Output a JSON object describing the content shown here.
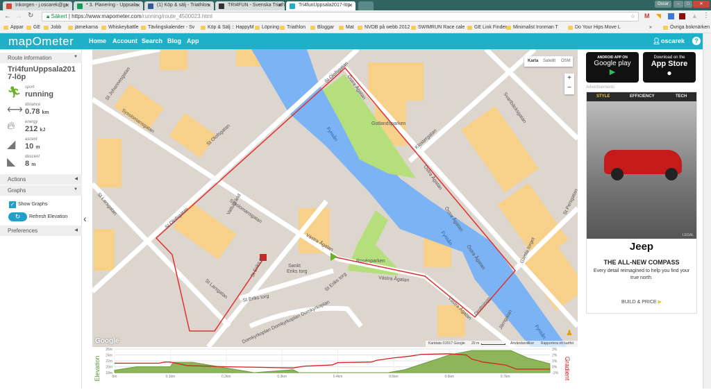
{
  "browser": {
    "tabs": [
      {
        "title": "Inkorgen - j.oscarek@gr",
        "icon_color": "#d44638"
      },
      {
        "title": "* 3. Planering - Uppsala",
        "icon_color": "#0f9d58"
      },
      {
        "title": "(1) Köp & sälj - Triathlon",
        "icon_color": "#3b5998"
      },
      {
        "title": "TRI4FUN - Svenska Triath",
        "icon_color": "#333333"
      },
      {
        "title": "Tri4funUppsala2017-löp",
        "icon_color": "#1fb0c9",
        "active": true
      }
    ],
    "user_button": "Oscar",
    "secure_label": "Säkert",
    "url_host": "https://www.mapometer.com",
    "url_path": "/running/route_4500023.html",
    "bookmarks": [
      "Appar",
      "GE",
      "Jobb",
      "järnekarna",
      "Whiskeybattle",
      "Tävlingskalender - Sv",
      "Köp & Sälj :: HappyM",
      "Löpning",
      "Triathlon",
      "Bloggar",
      "Mat",
      "NVDB på webb 2012",
      "SWIMRUN Race cale",
      "GE Link Finder",
      "Minimalist Ironman T",
      "Do Your Hips Move L"
    ],
    "bookmarks_overflow": "»",
    "other_bookmarks": "Övriga bokmärken"
  },
  "header": {
    "logo": "mapOmeter",
    "nav": [
      "Home",
      "Account",
      "Search",
      "Blog",
      "App"
    ],
    "user": "oscarek",
    "help": "?"
  },
  "sidebar": {
    "route_info_label": "Route information",
    "route_name": "Tri4funUppsala2017-löp",
    "stats": [
      {
        "label": "sport",
        "value": "running",
        "unit": "",
        "icon": "runner-icon",
        "color": "#6bb12e"
      },
      {
        "label": "distance",
        "value": "0.78",
        "unit": "km",
        "icon": "distance-arrow-icon"
      },
      {
        "label": "energy",
        "value": "212",
        "unit": "kJ",
        "icon": "flame-icon"
      },
      {
        "label": "ascent",
        "value": "10",
        "unit": "m",
        "icon": "ascent-icon"
      },
      {
        "label": "descent",
        "value": "8",
        "unit": "m",
        "icon": "descent-icon"
      }
    ],
    "actions_label": "Actions",
    "graphs_label": "Graphs",
    "show_graphs_label": "Show Graphs",
    "show_graphs_checked": true,
    "refresh_label": "Refresh Elevation",
    "preferences_label": "Preferences"
  },
  "map": {
    "type_buttons": [
      "Karta",
      "Satellit",
      "OSM"
    ],
    "zoom_in": "+",
    "zoom_out": "−",
    "google": "Google",
    "attribution": "Kartdata ©2017 Google",
    "scale": "20 m",
    "terms": "Användarvillkor",
    "report": "Rapportera ett kartfel",
    "labels": [
      "St Johannesgatan",
      "Sysslomansgatan",
      "Sysslomansgatan",
      "St Olofsgatan",
      "St Olofsgatan",
      "St Olofsgatan",
      "Gotlandsparken",
      "Fyrisån",
      "Fyrisån",
      "Fyrisån",
      "Klostergatan",
      "Svartbäcksgatan",
      "Östra Ågatan",
      "Östra Ågatan",
      "Östra Ågatan",
      "Östra Ågatan",
      "St Larsgatan",
      "St Larsgatan",
      "Vattugränd",
      "Västra Ågatan",
      "Västra Ågatan",
      "Västra Ågatan",
      "Rosénparken",
      "Sankt",
      "Eriks torg",
      "St Eriks torg",
      "St Eriks torg",
      "St Eriks gr",
      "Domkyrkoplan Domkyrkoplan Domkyrkoplan",
      "Gamla torget",
      "St Persgatan",
      "Drottningg",
      "Järngatan"
    ],
    "route_color": "#e03030"
  },
  "ads": {
    "google_play_top": "ANDROID APP ON",
    "google_play": "Google play",
    "app_store_top": "Download on the",
    "app_store": "App Store",
    "ads_label": "Advertisements",
    "tabs": [
      "STYLE",
      "EFFICIENCY",
      "TECH"
    ],
    "legal": "LEGAL",
    "brand": "Jeep",
    "headline": "THE ALL-NEW COMPASS",
    "body": "Every detail reimagined to help you find your true north.",
    "cta": "BUILD & PRICE"
  },
  "chart_data": {
    "type": "area+line",
    "ylabel": "Elevation",
    "y2label": "Gradient",
    "xlim": [
      0,
      0.78
    ],
    "ylim": [
      18,
      26
    ],
    "y2lim": [
      -1,
      3
    ],
    "xticks": [
      "0m",
      "0.1km",
      "0.2km",
      "0.3km",
      "0.4km",
      "0.5km",
      "0.6km",
      "0.7km"
    ],
    "yticks": [
      "26m",
      "24m",
      "22m",
      "20m",
      "18m"
    ],
    "y2ticks": [
      "3%",
      "2%",
      "1%",
      "0%",
      "-1%"
    ],
    "grid": true,
    "elevation": {
      "color": "#6a9a3a",
      "x": [
        0,
        0.04,
        0.1,
        0.105,
        0.14,
        0.25,
        0.32,
        0.33,
        0.49,
        0.52,
        0.6,
        0.64,
        0.71,
        0.74,
        0.78
      ],
      "y": [
        18.8,
        20,
        20,
        21.5,
        21.5,
        18,
        19,
        18,
        18,
        19,
        24,
        25.5,
        25.5,
        23,
        21
      ]
    },
    "gradient": {
      "color": "#d62020",
      "x": [
        0,
        0.08,
        0.09,
        0.1,
        0.13,
        0.2,
        0.32,
        0.34,
        0.39,
        0.4,
        0.46,
        0.47,
        0.5,
        0.53,
        0.55,
        0.6,
        0.63,
        0.64,
        0.66,
        0.7,
        0.72,
        0.78
      ],
      "y": [
        0.6,
        0.6,
        0.8,
        0.8,
        0.2,
        0,
        -0.2,
        0.1,
        0.3,
        0.7,
        0.8,
        1.1,
        1.5,
        1.8,
        2.1,
        2.2,
        2.0,
        1.3,
        0.8,
        0.3,
        -0.4,
        -0.4
      ]
    }
  }
}
